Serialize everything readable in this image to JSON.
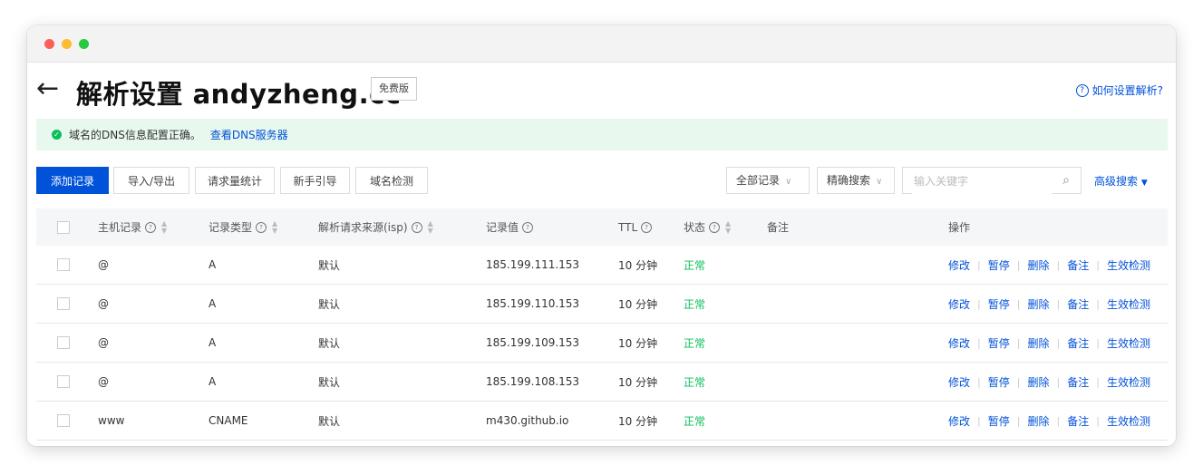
{
  "header": {
    "back_icon": "arrow-left-icon",
    "title": "解析设置 andyzheng.cc",
    "badge": "免费版",
    "help_link": "如何设置解析?"
  },
  "notice": {
    "text": "域名的DNS信息配置正确。",
    "link": "查看DNS服务器"
  },
  "toolbar": {
    "add_record": "添加记录",
    "import_export": "导入/导出",
    "request_stats": "请求量统计",
    "beginner_guide": "新手引导",
    "domain_check": "域名检测",
    "filter_records": "全部记录",
    "search_mode": "精确搜索",
    "search_placeholder": "输入关键字",
    "advanced_search": "高级搜索"
  },
  "table": {
    "columns": {
      "host": "主机记录",
      "type": "记录类型",
      "line": "解析请求来源(isp)",
      "value": "记录值",
      "ttl": "TTL",
      "status": "状态",
      "remark": "备注",
      "actions": "操作"
    },
    "action_labels": [
      "修改",
      "暂停",
      "删除",
      "备注",
      "生效检测"
    ],
    "rows": [
      {
        "host": "@",
        "type": "A",
        "line": "默认",
        "value": "185.199.111.153",
        "ttl": "10 分钟",
        "status": "正常",
        "remark": ""
      },
      {
        "host": "@",
        "type": "A",
        "line": "默认",
        "value": "185.199.110.153",
        "ttl": "10 分钟",
        "status": "正常",
        "remark": ""
      },
      {
        "host": "@",
        "type": "A",
        "line": "默认",
        "value": "185.199.109.153",
        "ttl": "10 分钟",
        "status": "正常",
        "remark": ""
      },
      {
        "host": "@",
        "type": "A",
        "line": "默认",
        "value": "185.199.108.153",
        "ttl": "10 分钟",
        "status": "正常",
        "remark": ""
      },
      {
        "host": "www",
        "type": "CNAME",
        "line": "默认",
        "value": "m430.github.io",
        "ttl": "10 分钟",
        "status": "正常",
        "remark": ""
      }
    ]
  },
  "colors": {
    "primary": "#0052d9",
    "success": "#0abf5b",
    "notice_bg": "#e8f8ee"
  }
}
